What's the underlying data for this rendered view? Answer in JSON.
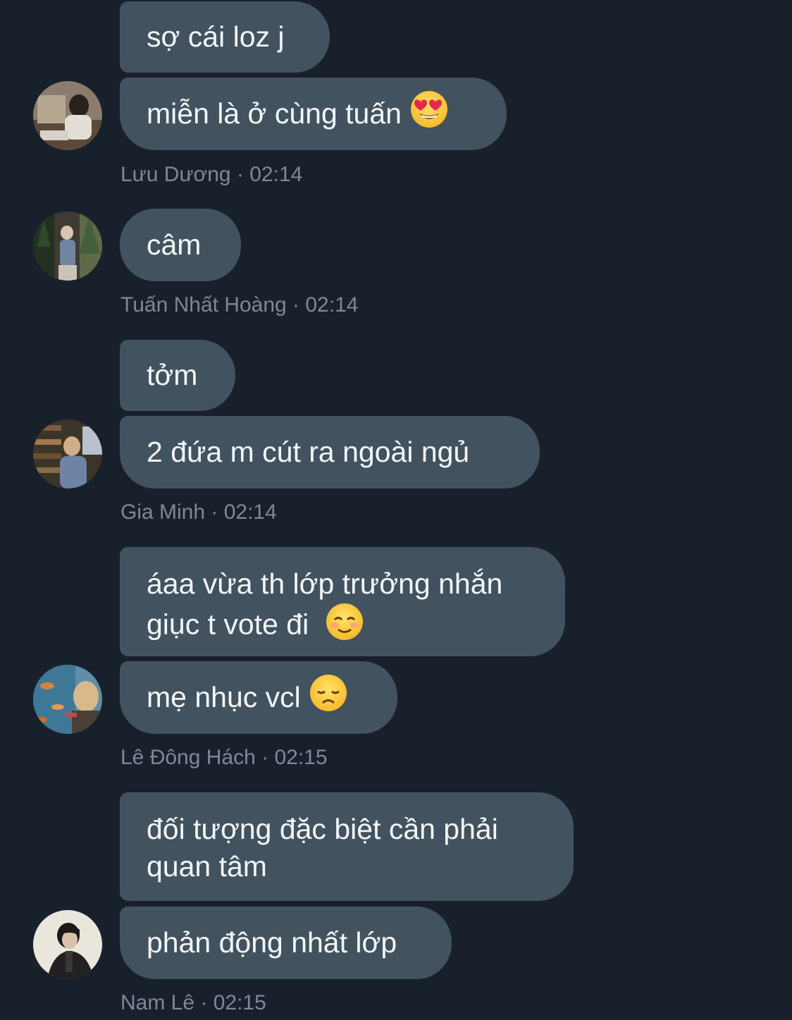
{
  "messages": [
    {
      "sender": "Lưu Dương",
      "time": "02:14",
      "meta": "Lưu Dương · 02:14",
      "bubbles": [
        {
          "text": "sợ cái loz j"
        },
        {
          "text": "miễn là ở cùng tuấn",
          "emoji": "heart-eyes-emoji"
        }
      ]
    },
    {
      "sender": "Tuấn Nhất Hoàng",
      "time": "02:14",
      "meta": "Tuấn Nhất Hoàng · 02:14",
      "bubbles": [
        {
          "text": "câm"
        }
      ]
    },
    {
      "sender": "Gia Minh",
      "time": "02:14",
      "meta": "Gia Minh · 02:14",
      "bubbles": [
        {
          "text": "tởm"
        },
        {
          "text": "2 đứa m cút ra ngoài ngủ"
        }
      ]
    },
    {
      "sender": "Lê Đông Hách",
      "time": "02:15",
      "meta": "Lê Đông Hách · 02:15",
      "bubbles": [
        {
          "line1": "áaa vừa th lớp trưởng nhắn",
          "line2": "giục t vote đi",
          "emoji": "smiling-blush-emoji"
        },
        {
          "text": "mẹ nhục vcl",
          "emoji": "disappointed-face-emoji"
        }
      ]
    },
    {
      "sender": "Nam Lê",
      "time": "02:15",
      "meta": "Nam Lê · 02:15",
      "bubbles": [
        {
          "line1": "đối tượng đặc biệt cần phải",
          "line2": "quan tâm"
        },
        {
          "text": "phản động nhất lớp"
        }
      ]
    }
  ],
  "colors": {
    "background": "#18202b",
    "bubble": "#43525f",
    "bubble_text": "#f3f6f9",
    "meta_text": "#7d8a96"
  }
}
